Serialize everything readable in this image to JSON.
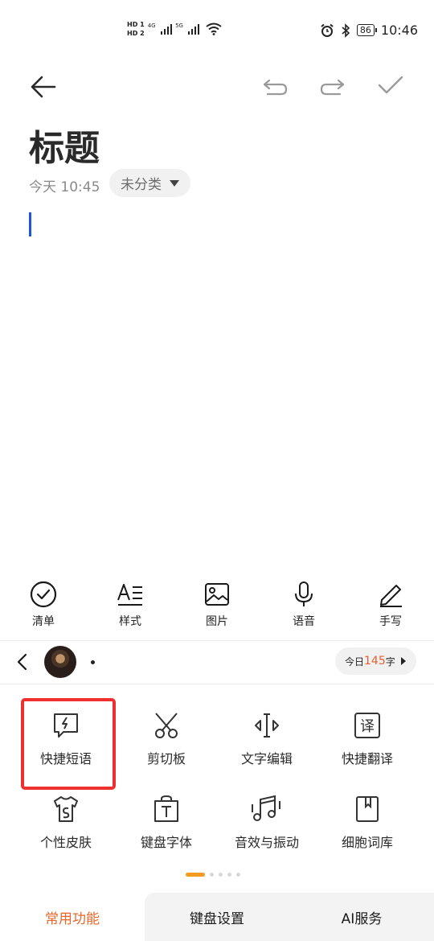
{
  "status_bar": {
    "hd1": "HD 1",
    "hd2": "HD 2",
    "net1": "4G",
    "net2": "5G",
    "battery": "86",
    "time": "10:46"
  },
  "toolbar": {
    "back_icon": "arrow-left-icon",
    "undo_icon": "undo-icon",
    "redo_icon": "redo-icon",
    "confirm_icon": "check-icon"
  },
  "note": {
    "title": "标题",
    "date": "今天 10:45",
    "category": "未分类"
  },
  "quick_tools": [
    {
      "label": "清单",
      "icon": "checklist-icon"
    },
    {
      "label": "样式",
      "icon": "text-style-icon"
    },
    {
      "label": "图片",
      "icon": "image-icon"
    },
    {
      "label": "语音",
      "icon": "microphone-icon"
    },
    {
      "label": "手写",
      "icon": "pen-icon"
    }
  ],
  "ime": {
    "word_count_prefix": "今日",
    "word_count_value": "145",
    "word_count_suffix": "字",
    "features": [
      {
        "label": "快捷短语",
        "icon": "quick-phrase-icon",
        "highlighted": true
      },
      {
        "label": "剪切板",
        "icon": "scissors-icon"
      },
      {
        "label": "文字编辑",
        "icon": "text-edit-icon"
      },
      {
        "label": "快捷翻译",
        "icon": "translate-icon"
      },
      {
        "label": "个性皮肤",
        "icon": "tshirt-icon"
      },
      {
        "label": "键盘字体",
        "icon": "font-bag-icon"
      },
      {
        "label": "音效与振动",
        "icon": "music-icon"
      },
      {
        "label": "细胞词库",
        "icon": "book-icon"
      }
    ],
    "tabs": [
      "常用功能",
      "键盘设置",
      "AI服务"
    ],
    "active_tab": 0,
    "colors": {
      "accent": "#e8662a",
      "highlight": "#ef3030",
      "pager": "#f39a1f",
      "caret": "#1c56d8"
    }
  }
}
